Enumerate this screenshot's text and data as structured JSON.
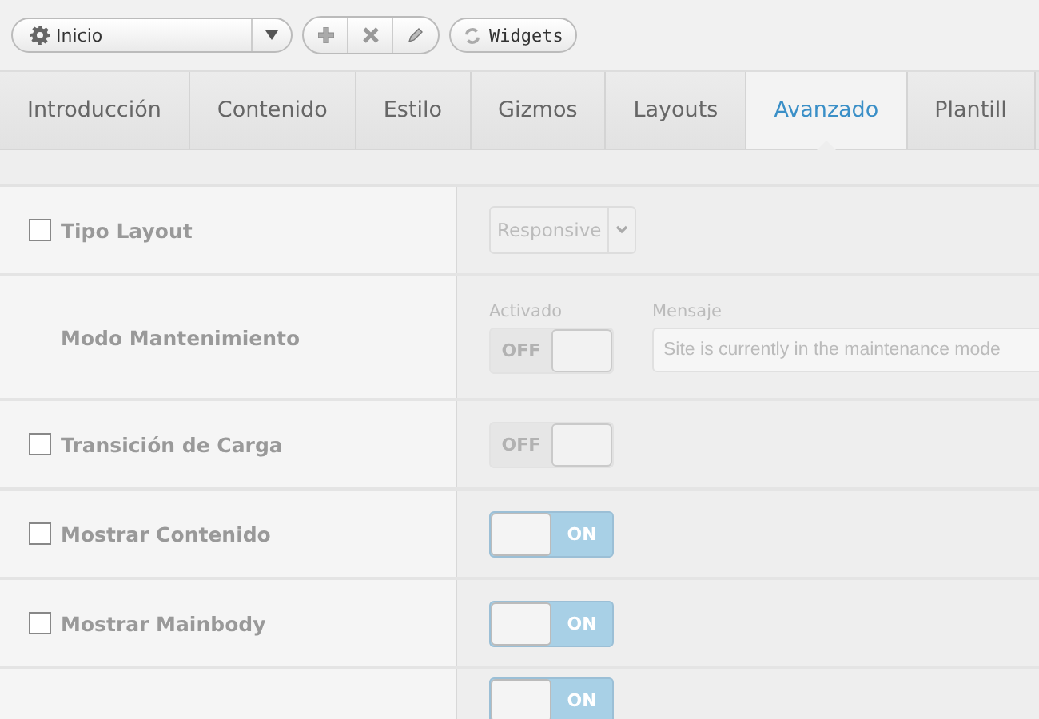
{
  "toolbar": {
    "page_select": {
      "value": "Inicio"
    },
    "widgets_button": "Widgets"
  },
  "tabs": [
    {
      "label": "Introducción",
      "selected": false
    },
    {
      "label": "Contenido",
      "selected": false
    },
    {
      "label": "Estilo",
      "selected": false
    },
    {
      "label": "Gizmos",
      "selected": false
    },
    {
      "label": "Layouts",
      "selected": false
    },
    {
      "label": "Avanzado",
      "selected": true
    },
    {
      "label": "Plantill",
      "selected": false
    }
  ],
  "rows": [
    {
      "kind": "select",
      "label": "Tipo Layout",
      "checked": false,
      "value": "Responsive",
      "disabled": true
    },
    {
      "kind": "maintenance",
      "label": "Modo Mantenimiento",
      "toggle_label": "Activado",
      "message_label": "Mensaje",
      "on": false,
      "disabled": true,
      "off_text": "OFF",
      "message_placeholder": "Site is currently in the maintenance mode"
    },
    {
      "kind": "toggle",
      "label": "Transición de Carga",
      "checked": false,
      "on": false,
      "disabled": true,
      "off_text": "OFF"
    },
    {
      "kind": "toggle",
      "label": "Mostrar Contenido",
      "checked": false,
      "on": true,
      "disabled": false,
      "on_text": "ON"
    },
    {
      "kind": "toggle",
      "label": "Mostrar Mainbody",
      "checked": false,
      "on": true,
      "disabled": false,
      "on_text": "ON"
    },
    {
      "kind": "toggle",
      "on": true,
      "disabled": false,
      "on_text": "ON"
    }
  ]
}
